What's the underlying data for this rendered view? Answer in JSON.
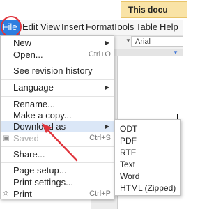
{
  "notice": {
    "text": "This docu"
  },
  "menubar": {
    "items": [
      "File",
      "Edit",
      "View",
      "Insert",
      "Format",
      "Tools",
      "Table",
      "Help"
    ]
  },
  "toolbar": {
    "font": "Arial"
  },
  "file_menu": {
    "new": {
      "label": "New"
    },
    "open": {
      "label": "Open...",
      "shortcut": "Ctrl+O"
    },
    "revision_history": {
      "label": "See revision history"
    },
    "language": {
      "label": "Language"
    },
    "rename": {
      "label": "Rename..."
    },
    "make_copy": {
      "label": "Make a copy..."
    },
    "download_as": {
      "label": "Download as"
    },
    "saved": {
      "label": "Saved",
      "shortcut": "Ctrl+S"
    },
    "share": {
      "label": "Share..."
    },
    "page_setup": {
      "label": "Page setup..."
    },
    "print_settings": {
      "label": "Print settings..."
    },
    "print": {
      "label": "Print",
      "shortcut": "Ctrl+P"
    }
  },
  "download_submenu": {
    "items": [
      "ODT",
      "PDF",
      "RTF",
      "Text",
      "Word",
      "HTML (Zipped)"
    ]
  },
  "colors": {
    "accent": "#2d7ee0",
    "highlight": "#dbe7f7",
    "annotation": "#e0343c"
  }
}
